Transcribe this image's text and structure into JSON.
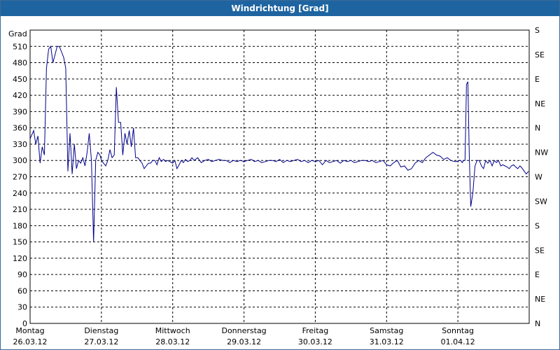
{
  "window": {
    "title": "Windrichtung [Grad]"
  },
  "chart_data": {
    "type": "line",
    "title": "Windrichtung [Grad]",
    "ylabel": "Grad",
    "ylim": [
      0,
      540
    ],
    "yticks": [
      0,
      30,
      60,
      90,
      120,
      150,
      180,
      210,
      240,
      270,
      300,
      330,
      360,
      390,
      420,
      450,
      480,
      510
    ],
    "right_axis_labels": [
      "N",
      "NE",
      "E",
      "SE",
      "S",
      "SW",
      "W",
      "NW",
      "N",
      "NE",
      "E",
      "SE",
      "S"
    ],
    "grid": true,
    "line_color": "#00008b",
    "x_ticks": [
      {
        "day": "Montag",
        "date": "26.03.12"
      },
      {
        "day": "Dienstag",
        "date": "27.03.12"
      },
      {
        "day": "Mittwoch",
        "date": "28.03.12"
      },
      {
        "day": "Donnerstag",
        "date": "29.03.12"
      },
      {
        "day": "Freitag",
        "date": "30.03.12"
      },
      {
        "day": "Samstag",
        "date": "31.03.12"
      },
      {
        "day": "Sonntag",
        "date": "01.04.12"
      }
    ],
    "series": [
      {
        "x": [
          0.0,
          0.05,
          0.08,
          0.11,
          0.14,
          0.17,
          0.2,
          0.23,
          0.26,
          0.29,
          0.32,
          0.35,
          0.38,
          0.41,
          0.44,
          0.47,
          0.5,
          0.53,
          0.56,
          0.59,
          0.62,
          0.65,
          0.68,
          0.71,
          0.74,
          0.77,
          0.8,
          0.83,
          0.86,
          0.89,
          0.92,
          0.95,
          0.98,
          1.0,
          1.03,
          1.06,
          1.09,
          1.12,
          1.15,
          1.18,
          1.21,
          1.24,
          1.27,
          1.3,
          1.33,
          1.36,
          1.39,
          1.42,
          1.45,
          1.48,
          1.51,
          1.54,
          1.57,
          1.6,
          1.63,
          1.66,
          1.69,
          1.72,
          1.75,
          1.78,
          1.81,
          1.84,
          1.87,
          1.9,
          1.93,
          1.96,
          2.0,
          2.03,
          2.06,
          2.09,
          2.12,
          2.15,
          2.18,
          2.21,
          2.24,
          2.27,
          2.3,
          2.35,
          2.4,
          2.45,
          2.5,
          2.55,
          2.6,
          2.65,
          2.7,
          2.75,
          2.8,
          2.85,
          2.9,
          2.95,
          3.0,
          3.05,
          3.1,
          3.15,
          3.2,
          3.25,
          3.3,
          3.35,
          3.4,
          3.45,
          3.5,
          3.55,
          3.6,
          3.65,
          3.7,
          3.75,
          3.8,
          3.85,
          3.9,
          3.95,
          4.0,
          4.05,
          4.1,
          4.15,
          4.2,
          4.25,
          4.3,
          4.35,
          4.4,
          4.45,
          4.5,
          4.55,
          4.6,
          4.65,
          4.7,
          4.75,
          4.8,
          4.85,
          4.9,
          4.95,
          5.0,
          5.05,
          5.1,
          5.15,
          5.2,
          5.25,
          5.3,
          5.35,
          5.4,
          5.45,
          5.5,
          5.55,
          5.6,
          5.65,
          5.7,
          5.75,
          5.8,
          5.85,
          5.9,
          5.95,
          6.0,
          6.02,
          6.04,
          6.06,
          6.08,
          6.1,
          6.12,
          6.14,
          6.16,
          6.18,
          6.21,
          6.24,
          6.27,
          6.3,
          6.33,
          6.36,
          6.39,
          6.42,
          6.45,
          6.48,
          6.51,
          6.54,
          6.57,
          6.6,
          6.63,
          6.66,
          6.69,
          6.72,
          6.75,
          6.78,
          6.81,
          6.84,
          6.87,
          6.9,
          6.93,
          6.96,
          6.99
        ],
        "values": [
          340,
          355,
          330,
          345,
          295,
          325,
          310,
          470,
          505,
          510,
          480,
          495,
          510,
          510,
          500,
          490,
          470,
          280,
          350,
          275,
          330,
          285,
          300,
          295,
          305,
          290,
          315,
          350,
          300,
          150,
          300,
          315,
          310,
          300,
          295,
          290,
          300,
          320,
          305,
          310,
          435,
          370,
          370,
          310,
          350,
          330,
          355,
          325,
          360,
          305,
          305,
          300,
          295,
          285,
          290,
          295,
          295,
          300,
          300,
          292,
          305,
          298,
          302,
          298,
          300,
          298,
          295,
          300,
          285,
          292,
          300,
          296,
          302,
          298,
          300,
          305,
          300,
          305,
          296,
          300,
          302,
          298,
          300,
          302,
          300,
          300,
          296,
          300,
          298,
          300,
          298,
          300,
          302,
          298,
          300,
          296,
          298,
          300,
          300,
          298,
          302,
          296,
          300,
          298,
          300,
          302,
          298,
          300,
          296,
          300,
          298,
          300,
          292,
          300,
          296,
          298,
          300,
          295,
          300,
          298,
          300,
          296,
          298,
          300,
          300,
          298,
          300,
          296,
          298,
          300,
          292,
          290,
          296,
          300,
          288,
          290,
          282,
          285,
          295,
          300,
          296,
          305,
          310,
          315,
          310,
          308,
          302,
          305,
          300,
          298,
          298,
          300,
          300,
          296,
          300,
          300,
          440,
          445,
          310,
          215,
          240,
          290,
          300,
          300,
          290,
          285,
          300,
          295,
          300,
          290,
          300,
          296,
          300,
          290,
          292,
          290,
          288,
          285,
          290,
          292,
          288,
          285,
          290,
          286,
          280,
          275,
          280
        ]
      }
    ]
  }
}
